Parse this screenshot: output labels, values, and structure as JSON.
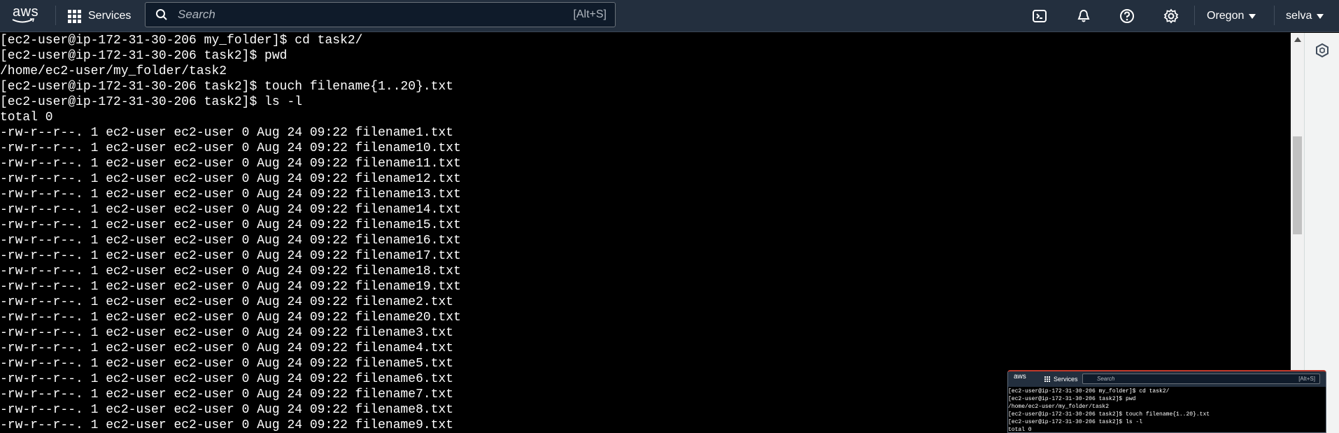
{
  "nav": {
    "logo_text": "aws",
    "services_label": "Services",
    "search_placeholder": "Search",
    "search_shortcut": "[Alt+S]",
    "region_label": "Oregon",
    "user_label": "selva",
    "icons": [
      "cloudshell-icon",
      "notifications-bell-icon",
      "help-icon",
      "settings-gear-icon"
    ]
  },
  "terminal": {
    "lines": [
      "[ec2-user@ip-172-31-30-206 my_folder]$ cd task2/",
      "[ec2-user@ip-172-31-30-206 task2]$ pwd",
      "/home/ec2-user/my_folder/task2",
      "[ec2-user@ip-172-31-30-206 task2]$ touch filename{1..20}.txt",
      "[ec2-user@ip-172-31-30-206 task2]$ ls -l",
      "total 0",
      "-rw-r--r--. 1 ec2-user ec2-user 0 Aug 24 09:22 filename1.txt",
      "-rw-r--r--. 1 ec2-user ec2-user 0 Aug 24 09:22 filename10.txt",
      "-rw-r--r--. 1 ec2-user ec2-user 0 Aug 24 09:22 filename11.txt",
      "-rw-r--r--. 1 ec2-user ec2-user 0 Aug 24 09:22 filename12.txt",
      "-rw-r--r--. 1 ec2-user ec2-user 0 Aug 24 09:22 filename13.txt",
      "-rw-r--r--. 1 ec2-user ec2-user 0 Aug 24 09:22 filename14.txt",
      "-rw-r--r--. 1 ec2-user ec2-user 0 Aug 24 09:22 filename15.txt",
      "-rw-r--r--. 1 ec2-user ec2-user 0 Aug 24 09:22 filename16.txt",
      "-rw-r--r--. 1 ec2-user ec2-user 0 Aug 24 09:22 filename17.txt",
      "-rw-r--r--. 1 ec2-user ec2-user 0 Aug 24 09:22 filename18.txt",
      "-rw-r--r--. 1 ec2-user ec2-user 0 Aug 24 09:22 filename19.txt",
      "-rw-r--r--. 1 ec2-user ec2-user 0 Aug 24 09:22 filename2.txt",
      "-rw-r--r--. 1 ec2-user ec2-user 0 Aug 24 09:22 filename20.txt",
      "-rw-r--r--. 1 ec2-user ec2-user 0 Aug 24 09:22 filename3.txt",
      "-rw-r--r--. 1 ec2-user ec2-user 0 Aug 24 09:22 filename4.txt",
      "-rw-r--r--. 1 ec2-user ec2-user 0 Aug 24 09:22 filename5.txt",
      "-rw-r--r--. 1 ec2-user ec2-user 0 Aug 24 09:22 filename6.txt",
      "-rw-r--r--. 1 ec2-user ec2-user 0 Aug 24 09:22 filename7.txt",
      "-rw-r--r--. 1 ec2-user ec2-user 0 Aug 24 09:22 filename8.txt",
      "-rw-r--r--. 1 ec2-user ec2-user 0 Aug 24 09:22 filename9.txt"
    ]
  },
  "thumbnail": {
    "logo_text": "aws",
    "services_label": "Services",
    "search_placeholder": "Search",
    "search_shortcut": "[Alt+S]",
    "lines": [
      "[ec2-user@ip-172-31-30-206 my_folder]$ cd task2/",
      "[ec2-user@ip-172-31-30-206 task2]$ pwd",
      "/home/ec2-user/my_folder/task2",
      "[ec2-user@ip-172-31-30-206 task2]$ touch filename{1..20}.txt",
      "[ec2-user@ip-172-31-30-206 task2]$ ls -l",
      "total 0"
    ]
  },
  "colors": {
    "nav_bg": "#232f3e",
    "terminal_bg": "#000000",
    "terminal_fg": "#ffffff",
    "accent_orange": "#ff9900"
  }
}
